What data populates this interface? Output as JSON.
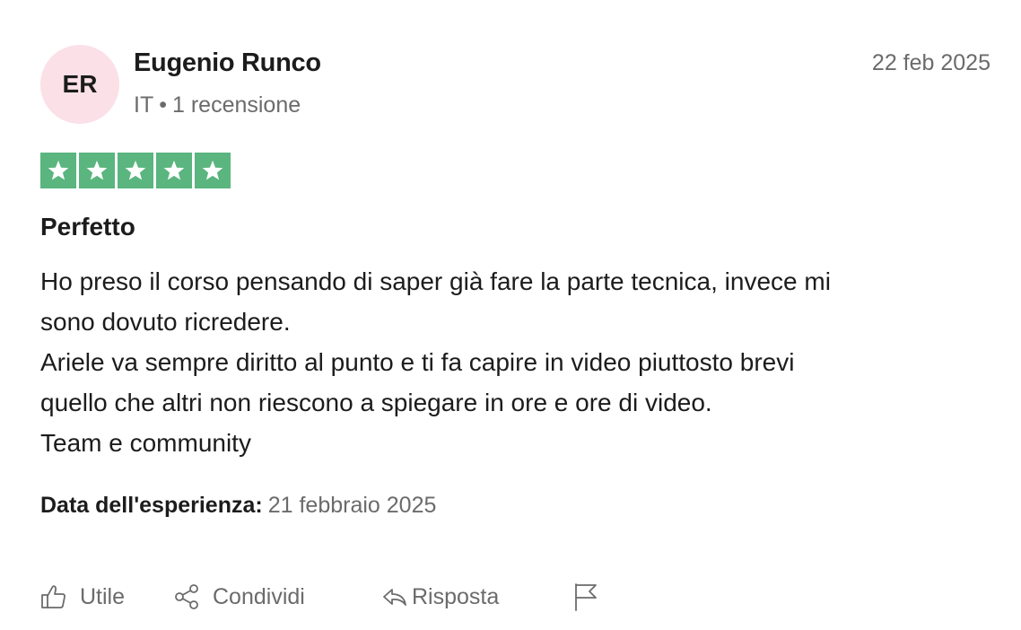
{
  "reviewer": {
    "initials": "ER",
    "name": "Eugenio Runco",
    "country": "IT",
    "separator": "•",
    "review_count": "1 recensione"
  },
  "review": {
    "date": "22 feb 2025",
    "rating": 5,
    "rating_max": 5,
    "star_color": "#5ab57f",
    "title": "Perfetto",
    "body_lines": [
      "Ho preso il corso pensando di saper già fare la parte tecnica, invece mi",
      "sono dovuto ricredere.",
      "Ariele va sempre diritto al punto e ti fa capire in video piuttosto brevi",
      "quello che altri non riescono a spiegare in ore e ore di video.",
      "Team e community"
    ],
    "experience_label": "Data dell'esperienza:",
    "experience_date": "21 febbraio 2025"
  },
  "actions": {
    "useful_label": "Utile",
    "useful_icon": "thumbs-up-icon",
    "share_label": "Condividi",
    "share_icon": "share-icon",
    "reply_label": "Risposta",
    "reply_icon": "reply-icon",
    "flag_icon": "flag-icon"
  }
}
